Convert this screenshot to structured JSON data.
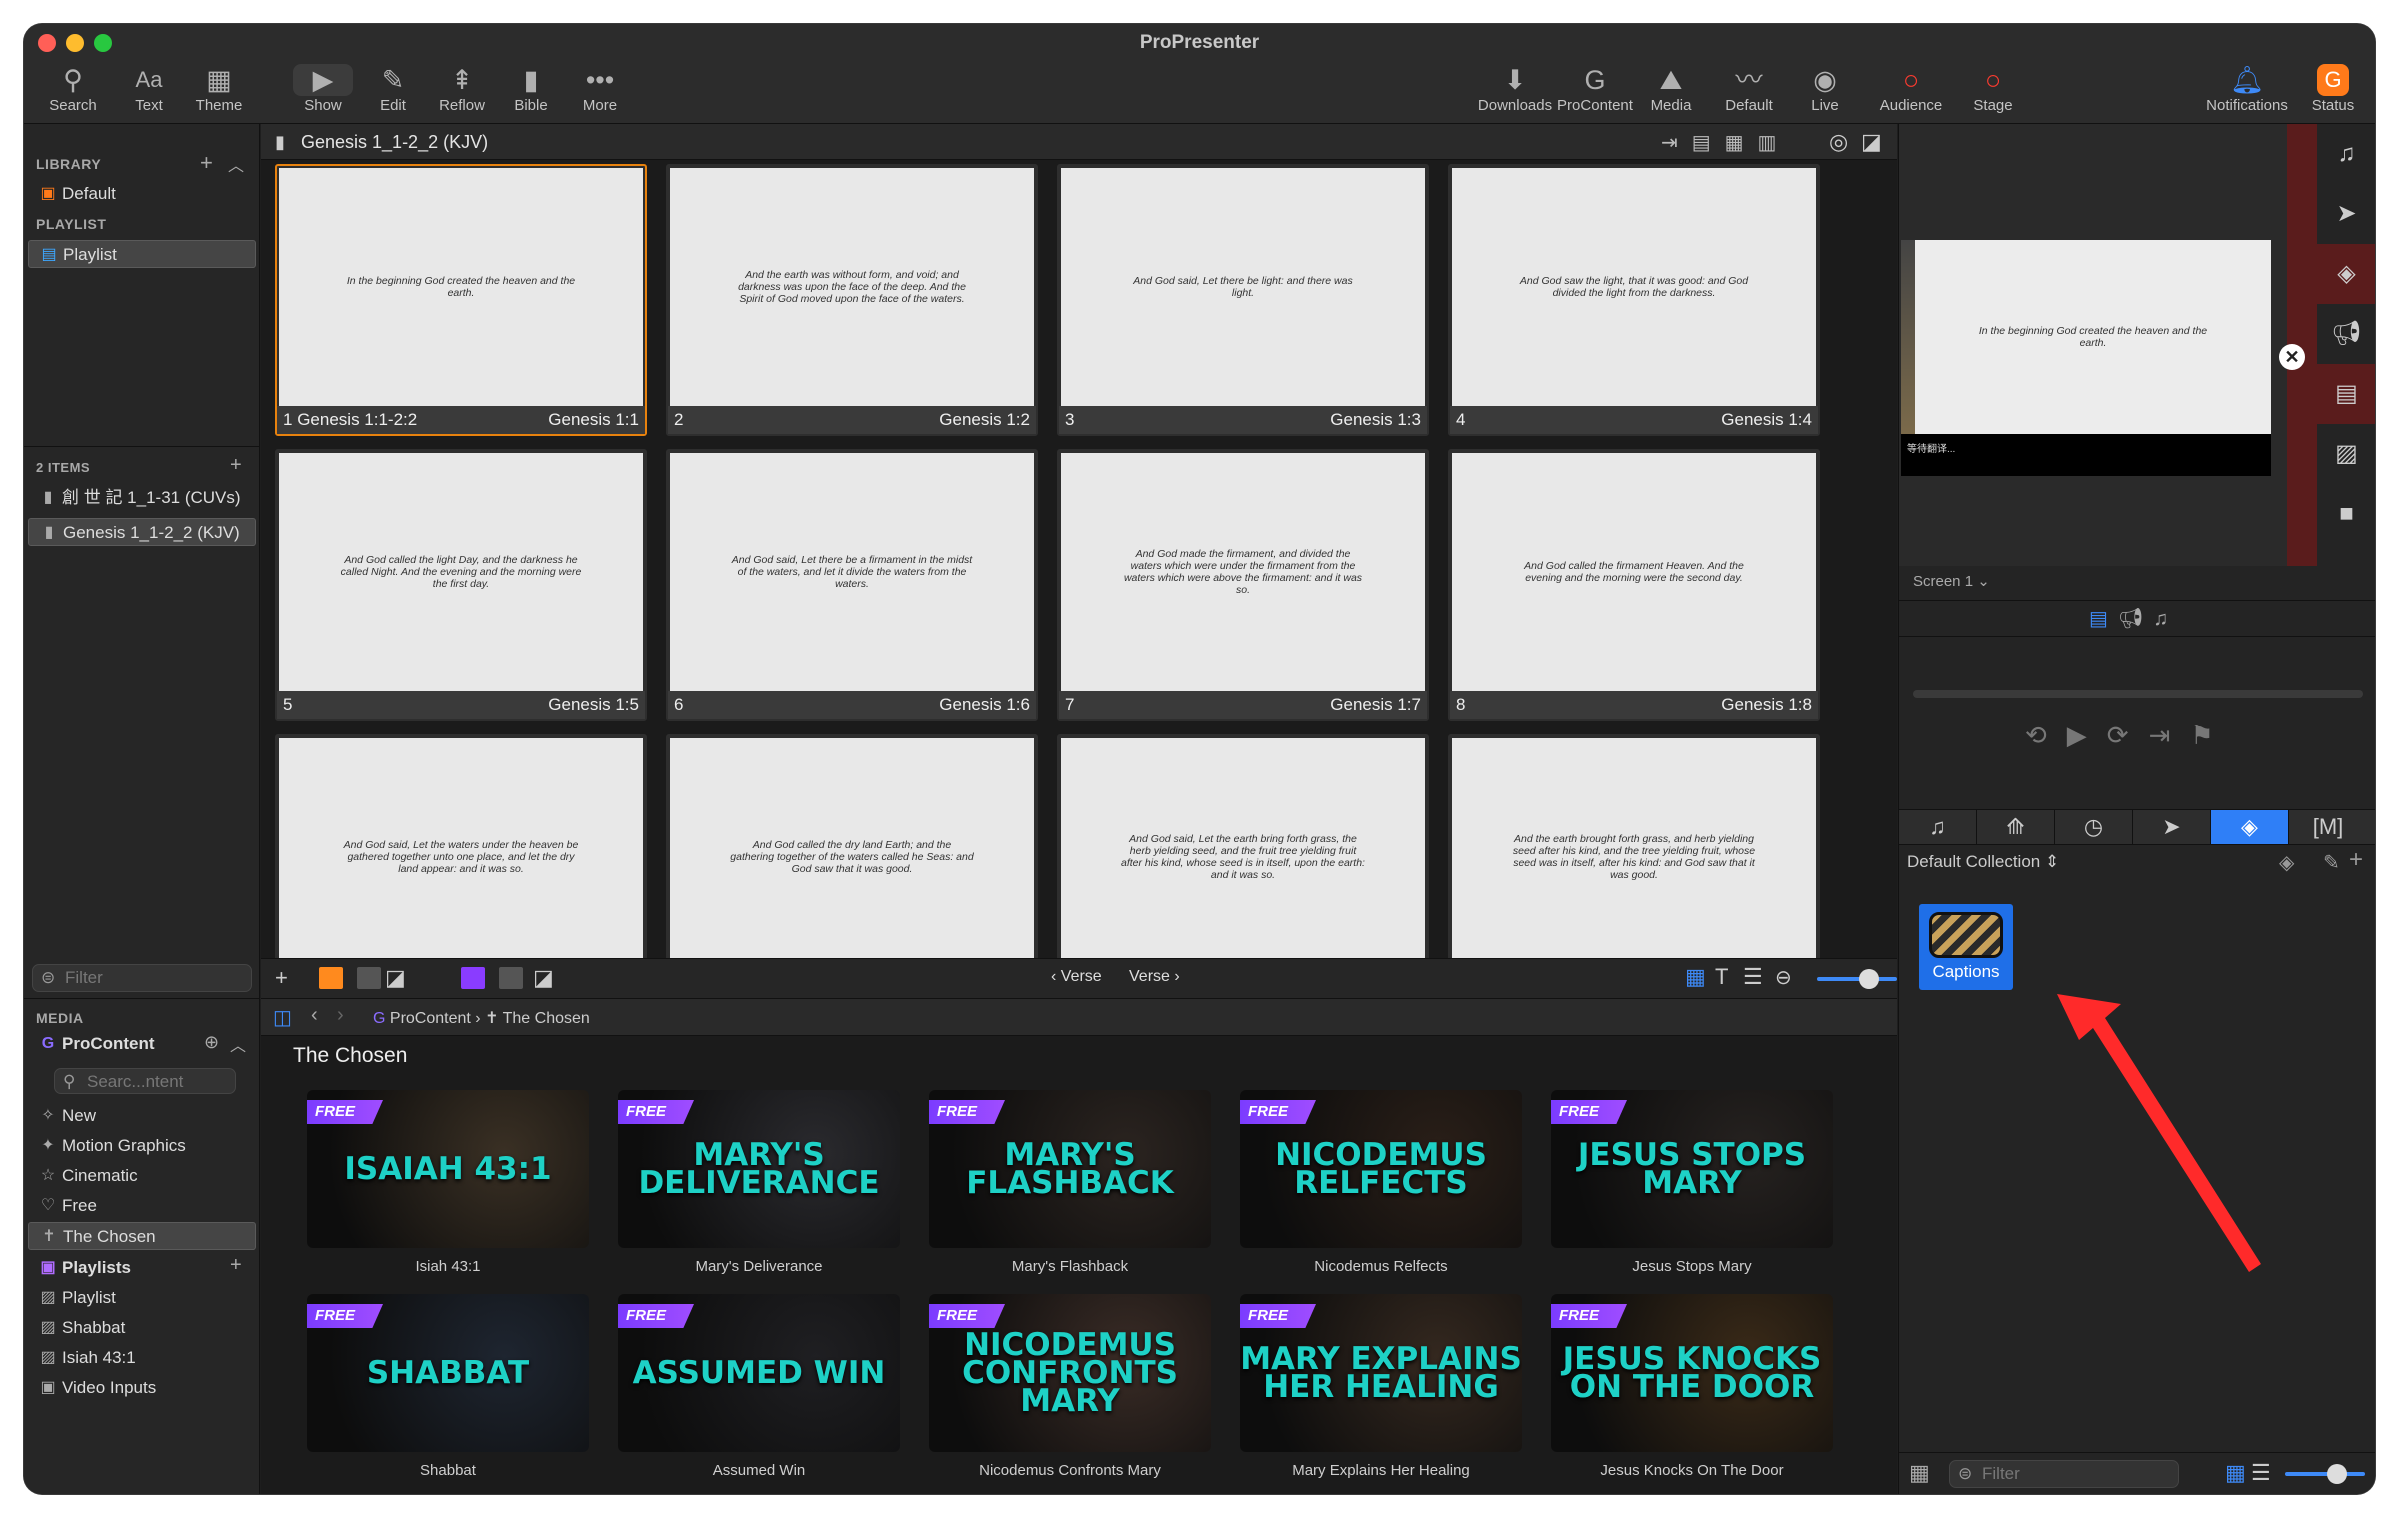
{
  "app_title": "ProPresenter",
  "toolbar": {
    "left": [
      {
        "label": "Search",
        "icon": "search-icon"
      },
      {
        "label": "Text",
        "icon": "text-icon"
      },
      {
        "label": "Theme",
        "icon": "theme-icon"
      }
    ],
    "center": [
      {
        "label": "Show",
        "icon": "play-icon"
      },
      {
        "label": "Edit",
        "icon": "pencil-icon"
      },
      {
        "label": "Reflow",
        "icon": "reflow-icon"
      },
      {
        "label": "Bible",
        "icon": "bible-icon"
      },
      {
        "label": "More",
        "icon": "more-icon"
      }
    ],
    "right": [
      {
        "label": "Downloads",
        "icon": "download-icon"
      },
      {
        "label": "ProContent",
        "icon": "procontent-icon"
      },
      {
        "label": "Media",
        "icon": "media-icon"
      },
      {
        "label": "Default",
        "icon": "mustache-icon"
      },
      {
        "label": "Live",
        "icon": "live-icon"
      },
      {
        "label": "Audience",
        "icon": "audience-icon"
      },
      {
        "label": "Stage",
        "icon": "stage-icon"
      },
      {
        "label": "Notifications",
        "icon": "bell-icon"
      },
      {
        "label": "Status",
        "icon": "status-icon"
      }
    ]
  },
  "library": {
    "heading": "LIBRARY",
    "default_item": "Default",
    "playlist_heading": "PLAYLIST",
    "playlist_item": "Playlist",
    "items_count": "2 ITEMS",
    "items": [
      "創 世 記 1_1-31 (CUVs)",
      "Genesis 1_1-2_2 (KJV)"
    ],
    "filter_placeholder": "Filter"
  },
  "media": {
    "heading": "MEDIA",
    "procontent": "ProContent",
    "search_placeholder": "Searc...ntent",
    "items": [
      "New",
      "Motion Graphics",
      "Cinematic",
      "Free",
      "The Chosen"
    ],
    "playlists_heading": "Playlists",
    "playlists": [
      "Playlist",
      "Shabbat",
      "Isiah 43:1",
      "Video Inputs"
    ]
  },
  "presentation": {
    "title": "Genesis 1_1-2_2 (KJV)",
    "slides": [
      {
        "num": "1",
        "group": "Genesis 1:1-2:2",
        "ref": "Genesis 1:1",
        "text": "In the beginning God created the heaven and the earth."
      },
      {
        "num": "2",
        "group": "",
        "ref": "Genesis 1:2",
        "text": "And the earth was without form, and void; and darkness was upon the face of the deep. And the Spirit of God moved upon the face of the waters."
      },
      {
        "num": "3",
        "group": "",
        "ref": "Genesis 1:3",
        "text": "And God said, Let there be light: and there was light."
      },
      {
        "num": "4",
        "group": "",
        "ref": "Genesis 1:4",
        "text": "And God saw the light, that it was good: and God divided the light from the darkness."
      },
      {
        "num": "5",
        "group": "",
        "ref": "Genesis 1:5",
        "text": "And God called the light Day, and the darkness he called Night. And the evening and the morning were the first day."
      },
      {
        "num": "6",
        "group": "",
        "ref": "Genesis 1:6",
        "text": "And God said, Let there be a firmament in the midst of the waters, and let it divide the waters from the waters."
      },
      {
        "num": "7",
        "group": "",
        "ref": "Genesis 1:7",
        "text": "And God made the firmament, and divided the waters which were under the firmament from the waters which were above the firmament: and it was so."
      },
      {
        "num": "8",
        "group": "",
        "ref": "Genesis 1:8",
        "text": "And God called the firmament Heaven. And the evening and the morning were the second day."
      },
      {
        "num": "",
        "group": "",
        "ref": "",
        "text": "And God said, Let the waters under the heaven be gathered together unto one place, and let the dry land appear: and it was so."
      },
      {
        "num": "",
        "group": "",
        "ref": "",
        "text": "And God called the dry land Earth; and the gathering together of the waters called he Seas: and God saw that it was good."
      },
      {
        "num": "",
        "group": "",
        "ref": "",
        "text": "And God said, Let the earth bring forth grass, the herb yielding seed, and the fruit tree yielding fruit after his kind, whose seed is in itself, upon the earth: and it was so."
      },
      {
        "num": "",
        "group": "",
        "ref": "",
        "text": "And the earth brought forth grass, and herb yielding seed after his kind, and the tree yielding fruit, whose seed was in itself, after his kind: and God saw that it was good."
      }
    ],
    "verse_prev": "Verse",
    "verse_next": "Verse"
  },
  "content": {
    "crumb1": "ProContent",
    "crumb2": "The Chosen",
    "section_title": "The Chosen",
    "free_badge": "FREE",
    "items": [
      {
        "title": "ISAIAH 43:1",
        "caption": "Isiah 43:1",
        "color": "#3a3024"
      },
      {
        "title": "MARY'S DELIVERANCE",
        "caption": "Mary's Deliverance",
        "color": "#2a2a2e"
      },
      {
        "title": "MARY'S FLASHBACK",
        "caption": "Mary's Flashback",
        "color": "#2b2420"
      },
      {
        "title": "NICODEMUS RELFECTS",
        "caption": "Nicodemus Relfects",
        "color": "#2a1f18"
      },
      {
        "title": "JESUS STOPS MARY",
        "caption": "Jesus Stops Mary",
        "color": "#262220"
      },
      {
        "title": "SHABBAT",
        "caption": "Shabbat",
        "color": "#1e2530"
      },
      {
        "title": "ASSUMED WIN",
        "caption": "Assumed Win",
        "color": "#1f1f22"
      },
      {
        "title": "NICODEMUS CONFRONTS MARY",
        "caption": "Nicodemus Confronts Mary",
        "color": "#3a2c26"
      },
      {
        "title": "MARY EXPLAINS HER HEALING",
        "caption": "Mary Explains Her Healing",
        "color": "#34281f"
      },
      {
        "title": "JESUS KNOCKS ON THE DOOR",
        "caption": "Jesus Knocks On The Door",
        "color": "#3a2a18"
      }
    ]
  },
  "preview": {
    "text": "In the beginning God created the heaven and the earth.",
    "caption_text": "等待翻译...",
    "screen": "Screen 1"
  },
  "props": {
    "collection": "Default Collection",
    "item_label": "Captions",
    "filter_placeholder": "Filter"
  }
}
